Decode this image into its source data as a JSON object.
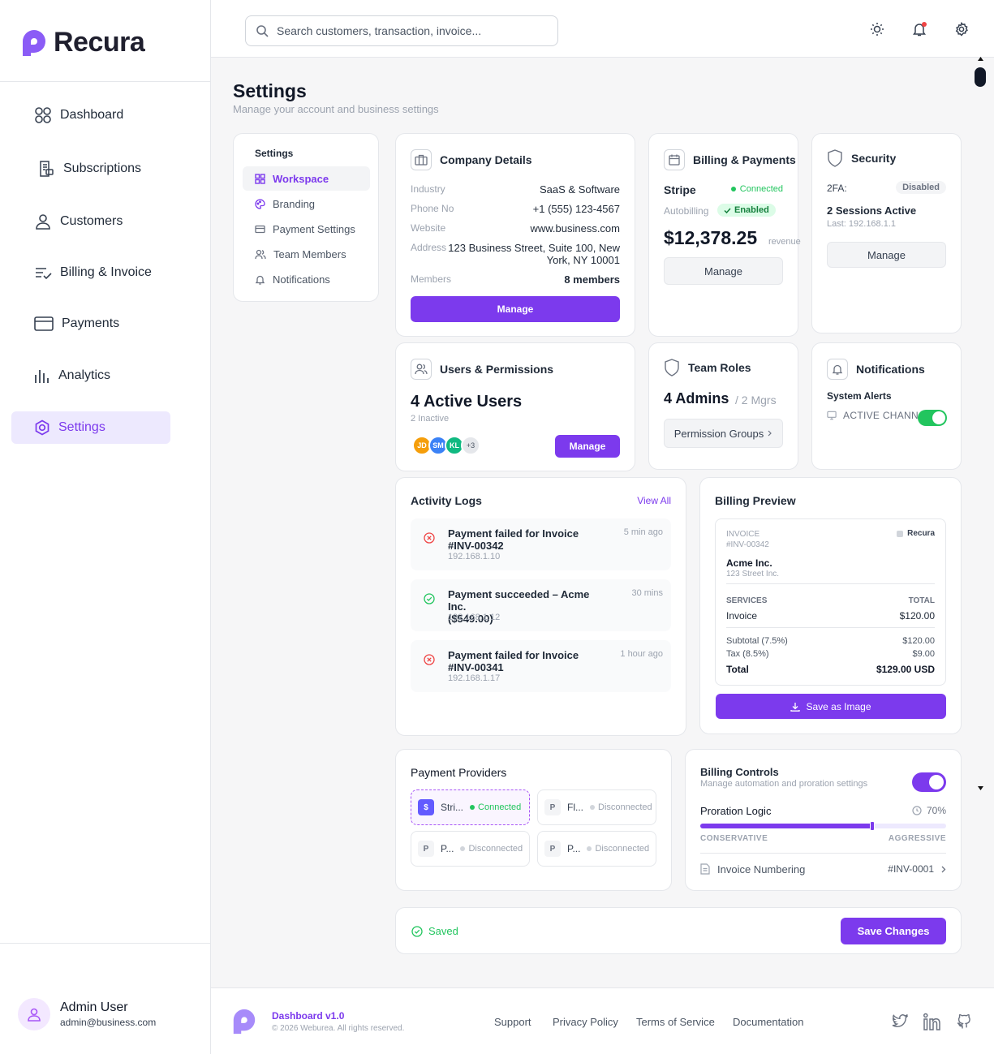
{
  "brand": {
    "name": "Recura"
  },
  "sidebar": {
    "items": [
      {
        "label": "Dashboard",
        "icon": "grid-icon"
      },
      {
        "label": "Subscriptions",
        "icon": "receipt-icon"
      },
      {
        "label": "Customers",
        "icon": "user-icon"
      },
      {
        "label": "Billing & Invoice",
        "icon": "list-check-icon"
      },
      {
        "label": "Payments",
        "icon": "wallet-icon"
      },
      {
        "label": "Analytics",
        "icon": "bar-chart-icon"
      },
      {
        "label": "Settings",
        "icon": "gear-icon",
        "active": true
      }
    ],
    "user": {
      "name": "Admin User",
      "email": "admin@business.com"
    }
  },
  "search": {
    "placeholder": "Search customers, transaction, invoice..."
  },
  "page": {
    "title": "Settings",
    "subtitle": "Manage your account and business settings"
  },
  "settings_menu": {
    "heading": "Settings",
    "items": [
      {
        "label": "Workspace",
        "active": true
      },
      {
        "label": "Branding"
      },
      {
        "label": "Payment Settings"
      },
      {
        "label": "Team Members"
      },
      {
        "label": "Notifications"
      }
    ]
  },
  "company": {
    "title": "Company Details",
    "industry_label": "Industry",
    "industry": "SaaS & Software",
    "phone_label": "Phone No",
    "phone": "+1 (555) 123-4567",
    "website_label": "Website",
    "website": "www.business.com",
    "address_label": "Address",
    "address_line1": "123 Business Street, Suite 100, New",
    "address_line2": "York, NY 10001",
    "members_label": "Members",
    "members": "8 members",
    "button": "Manage"
  },
  "billing": {
    "title": "Billing & Payments",
    "provider": "Stripe",
    "provider_status": "Connected",
    "autobilling_label": "Autobilling",
    "autobilling_status": "Enabled",
    "revenue": "$12,378.25",
    "revenue_label": "revenue",
    "button": "Manage"
  },
  "security": {
    "title": "Security",
    "twofa_label": "2FA:",
    "twofa_status": "Disabled",
    "sessions": "2 Sessions Active",
    "last": "Last: 192.168.1.1",
    "button": "Manage"
  },
  "users": {
    "title": "Users & Permissions",
    "active": "4 Active Users",
    "inactive": "2 Inactive",
    "avatars": [
      "JD",
      "SM",
      "KL",
      "+3"
    ],
    "button": "Manage"
  },
  "roles": {
    "title": "Team Roles",
    "admins": "4 Admins",
    "mgrs": "/ 2 Mgrs",
    "button": "Permission Groups"
  },
  "notifications": {
    "title": "Notifications",
    "alerts": "System Alerts",
    "channel": "ACTIVE CHANN",
    "enabled": true
  },
  "activity": {
    "title": "Activity Logs",
    "view_all": "View All",
    "logs": [
      {
        "line1": "Payment failed for Invoice",
        "line2": "#INV-00342",
        "ip": "192.168.1.10",
        "time": "5 min ago",
        "status": "failed"
      },
      {
        "line1": "Payment succeeded – Acme Inc.",
        "line2": "($549.00)",
        "ip": "192.168.1.12",
        "time": "30 mins",
        "status": "success"
      },
      {
        "line1": "Payment failed for Invoice",
        "line2": "#INV-00341",
        "ip": "192.168.1.17",
        "time": "1 hour ago",
        "status": "failed"
      }
    ]
  },
  "preview": {
    "title": "Billing Preview",
    "invoice_label": "INVOICE",
    "invoice_no": "#INV-00342",
    "brand": "Recura",
    "client": "Acme Inc.",
    "client_addr": "123 Street Inc.",
    "services_label": "SERVICES",
    "total_label": "TOTAL",
    "item": "Invoice",
    "item_amount": "$120.00",
    "subtotal_label": "Subtotal (7.5%)",
    "subtotal": "$120.00",
    "tax_label": "Tax (8.5%)",
    "tax": "$9.00",
    "grand_label": "Total",
    "grand": "$129.00 USD",
    "button": "Save as Image"
  },
  "providers": {
    "title": "Payment Providers",
    "items": [
      {
        "logo": "$",
        "name": "Stri...",
        "status": "Connected"
      },
      {
        "logo": "P",
        "name": "Fl...",
        "status": "Disconnected"
      },
      {
        "logo": "P",
        "name": "P...",
        "status": "Disconnected"
      },
      {
        "logo": "P",
        "name": "P...",
        "status": "Disconnected"
      }
    ]
  },
  "controls": {
    "title": "Billing Controls",
    "subtitle": "Manage automation and proration settings",
    "enabled": true,
    "proration_label": "Proration Logic",
    "proration_value": "70%",
    "proration": 0.7,
    "low": "CONSERVATIVE",
    "high": "AGGRESSIVE",
    "numbering_label": "Invoice Numbering",
    "numbering_value": "#INV-0001"
  },
  "save_bar": {
    "status": "Saved",
    "button": "Save Changes"
  },
  "footer": {
    "version": "Dashboard v1.0",
    "copyright": "© 2026 Weburea. All rights reserved.",
    "links": [
      "Support",
      "Privacy Policy",
      "Terms of Service",
      "Documentation"
    ]
  },
  "colors": {
    "accent": "#7c3aed",
    "success": "#22c55e",
    "danger": "#ef4444"
  }
}
